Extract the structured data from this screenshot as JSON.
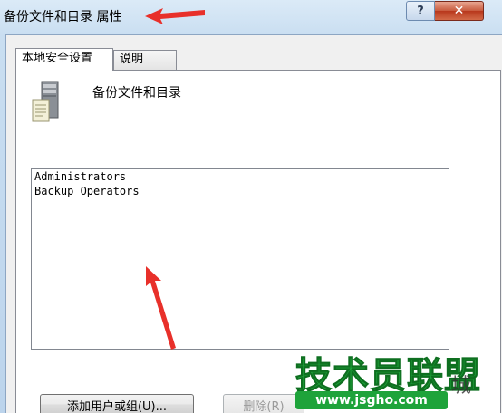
{
  "window": {
    "title": "备份文件和目录 属性",
    "help_label": "?",
    "close_label": "✕"
  },
  "tabs": [
    {
      "label": "本地安全设置",
      "active": true
    },
    {
      "label": "说明",
      "active": false
    }
  ],
  "policy": {
    "name": "备份文件和目录",
    "icon": "server-icon"
  },
  "members": [
    "Administrators",
    "Backup Operators"
  ],
  "buttons": {
    "add_label": "添加用户或组(U)...",
    "remove_label": "删除(R)"
  },
  "watermark": {
    "brand": "技术员联盟",
    "url": "www.jsgho.com",
    "side": "城"
  },
  "colors": {
    "annotation_arrow": "#e8302a",
    "watermark_green": "#1ea33a",
    "close_button": "#c85a3e"
  }
}
